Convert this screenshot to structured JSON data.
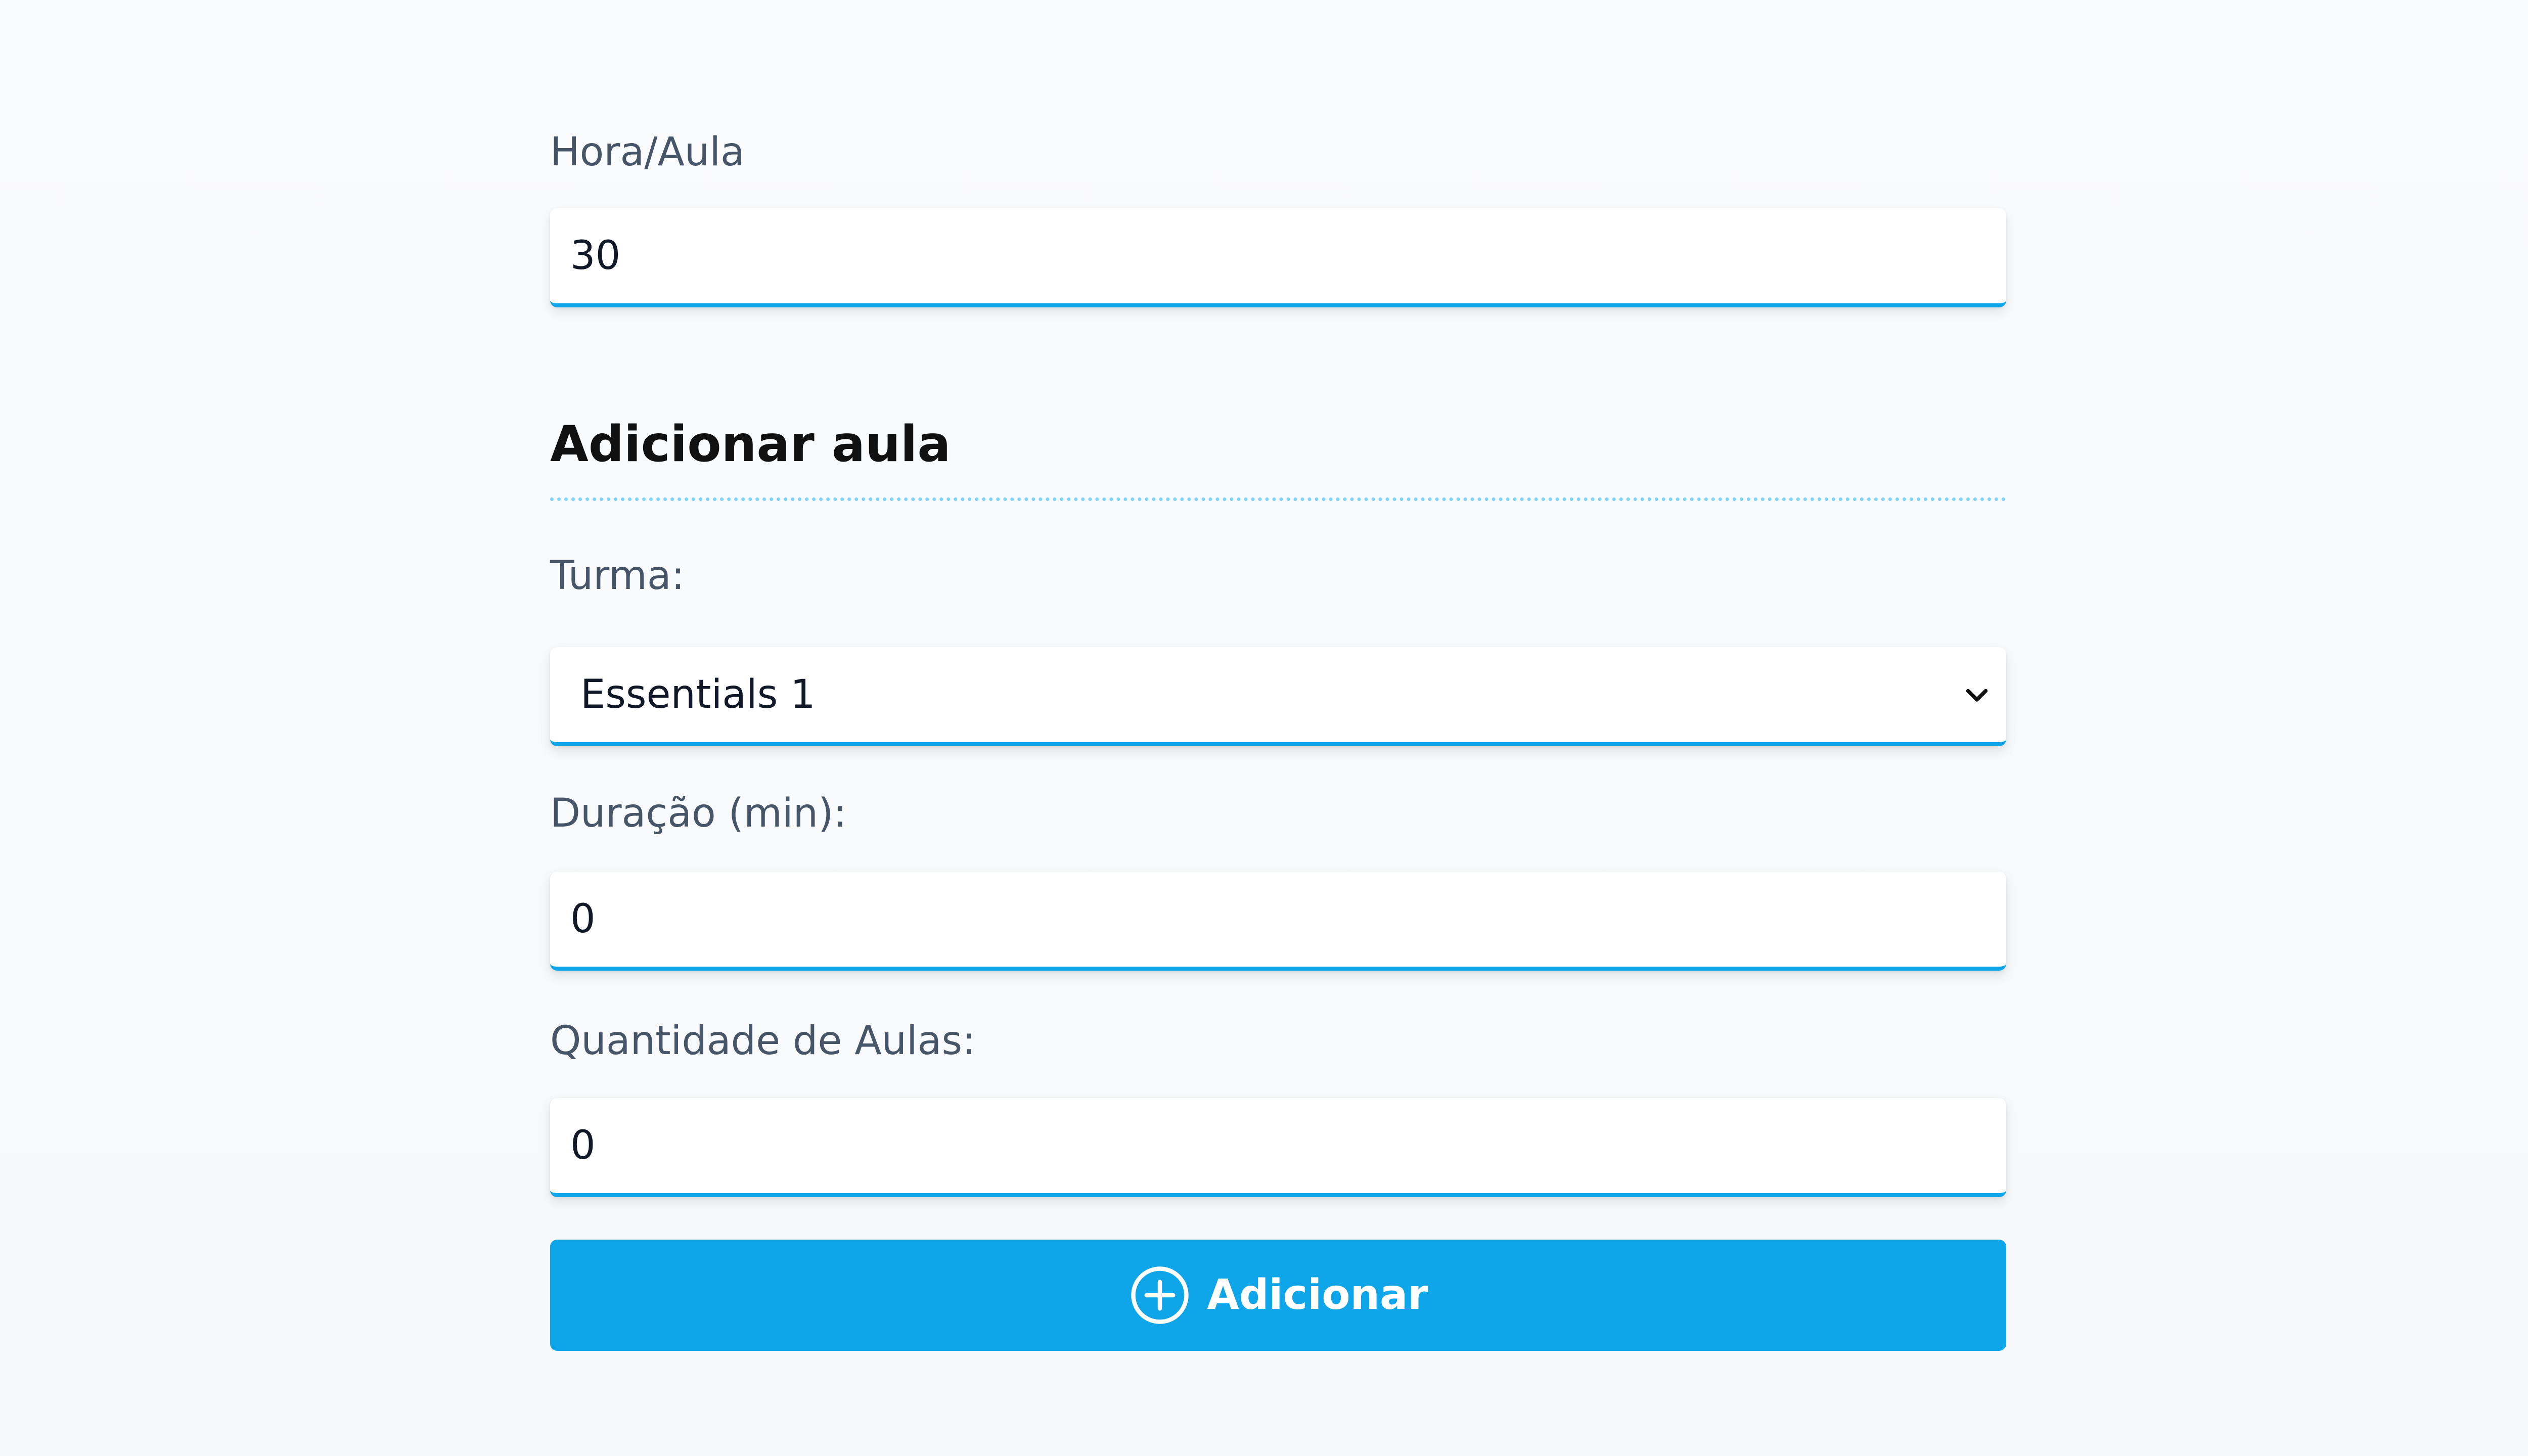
{
  "fields": {
    "hora_aula": {
      "label": "Hora/Aula",
      "value": "30"
    },
    "turma": {
      "label": "Turma:",
      "selected": "Essentials 1"
    },
    "duracao": {
      "label": "Duração (min):",
      "value": "0"
    },
    "quantidade": {
      "label": "Quantidade de Aulas:",
      "value": "0"
    }
  },
  "section": {
    "title": "Adicionar aula"
  },
  "submit": {
    "label": "Adicionar",
    "icon": "plus-circle-icon"
  },
  "colors": {
    "accent": "#0ea5e9",
    "label_text": "#475569",
    "divider": "#7dd3fc"
  }
}
